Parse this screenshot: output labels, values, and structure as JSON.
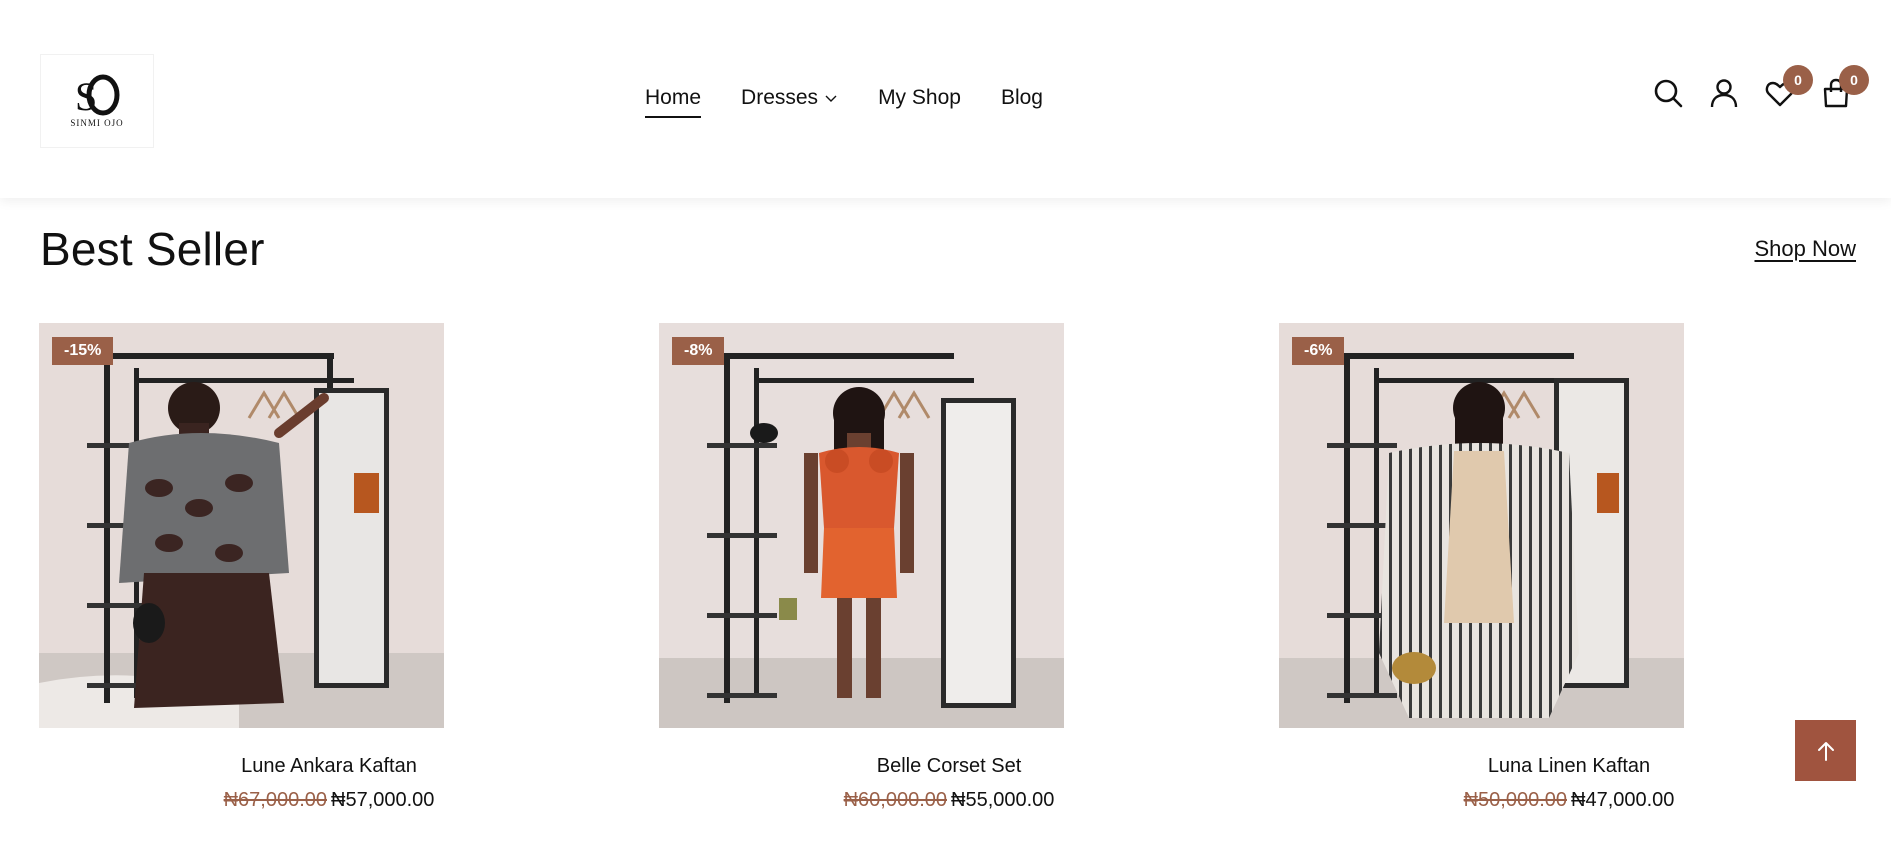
{
  "brand": {
    "logo_text": "SINMI OJO"
  },
  "nav": {
    "items": [
      {
        "label": "Home",
        "active": true
      },
      {
        "label": "Dresses",
        "has_dropdown": true
      },
      {
        "label": "My Shop"
      },
      {
        "label": "Blog"
      }
    ]
  },
  "header_icons": {
    "search": "search-icon",
    "account": "user-icon",
    "wishlist": {
      "icon": "heart-icon",
      "count": "0"
    },
    "cart": {
      "icon": "shopping-bag-icon",
      "count": "0"
    }
  },
  "section": {
    "title": "Best Seller",
    "shop_now": "Shop Now"
  },
  "products": [
    {
      "name": "Lune Ankara Kaftan",
      "badge": "-15%",
      "old_price": "₦67,000.00",
      "price": "₦57,000.00"
    },
    {
      "name": "Belle Corset Set",
      "badge": "-8%",
      "old_price": "₦60,000.00",
      "price": "₦55,000.00"
    },
    {
      "name": "Luna Linen Kaftan",
      "badge": "-6%",
      "old_price": "₦50,000.00",
      "price": "₦47,000.00"
    }
  ],
  "colors": {
    "accent": "#9a6048",
    "back_to_top": "#a0543f",
    "text": "#111111"
  }
}
